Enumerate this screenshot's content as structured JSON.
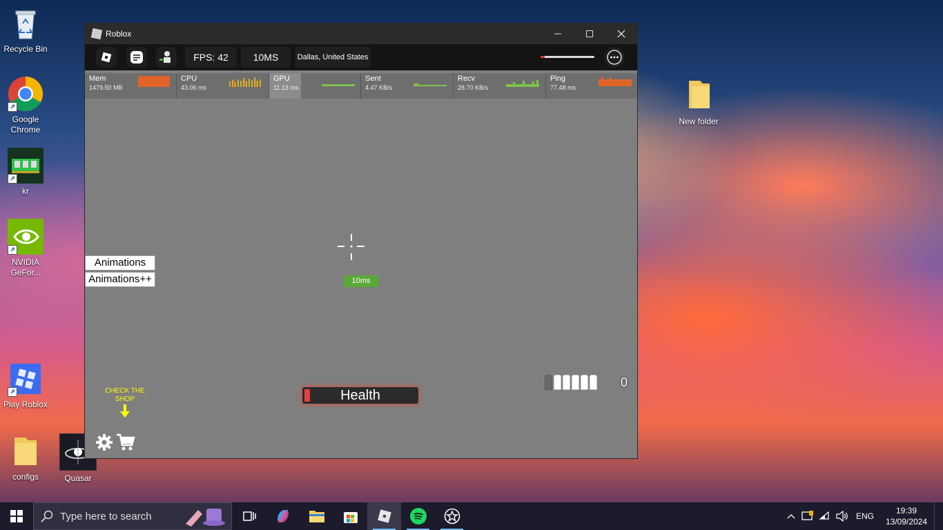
{
  "desktop": {
    "icons": {
      "recycle_bin": "Recycle Bin",
      "google_chrome": "Google Chrome",
      "kr": "kr",
      "nvidia": "NVIDIA GeFor...",
      "play_roblox": "Play Roblox",
      "configs": "configs",
      "quasar": "Quasar",
      "new_folder": "New folder"
    }
  },
  "window": {
    "title": "Roblox",
    "topbar": {
      "fps": "FPS: 42",
      "latency": "10MS",
      "location": "Dallas, United States"
    },
    "stats": [
      {
        "name": "Mem",
        "value": "1479.50 MB"
      },
      {
        "name": "CPU",
        "value": "43.06 ms"
      },
      {
        "name": "GPU",
        "value": "11.13 ms"
      },
      {
        "name": "Sent",
        "value": "4.47 KB/s"
      },
      {
        "name": "Recv",
        "value": "28.70 KB/s"
      },
      {
        "name": "Ping",
        "value": "77.48 ms"
      }
    ],
    "game": {
      "animations_button": "Animations",
      "animations_plus_button": "Animations++",
      "ping_badge": "10ms",
      "health_label": "Health",
      "health_level": 0.05,
      "ammo_count": "0",
      "ammo_total_slots": 6,
      "ammo_filled_slots": 5,
      "shop_hint": "CHECK THE SHOP"
    }
  },
  "taskbar": {
    "search_placeholder": "Type here to search",
    "language": "ENG",
    "time": "19:39",
    "date": "13/09/2024"
  },
  "colors": {
    "health_fill": "#e04040",
    "ping_badge": "#5aa837",
    "shop_hint": "#ffff00"
  }
}
